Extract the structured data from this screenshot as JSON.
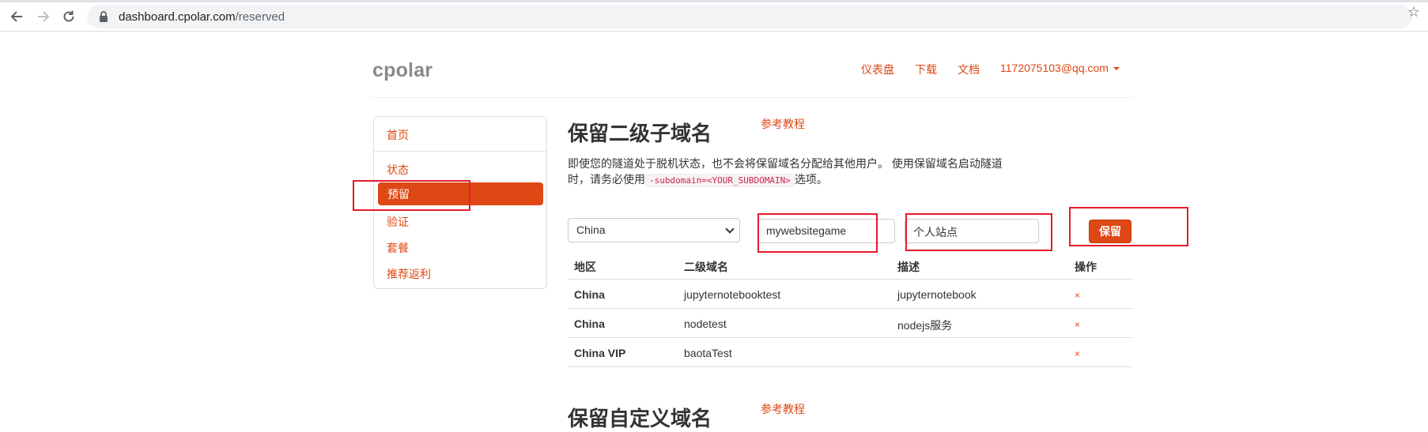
{
  "browser": {
    "url_host": "dashboard.cpolar.com",
    "url_path": "/reserved",
    "back_icon": "arrow-left-icon",
    "forward_icon": "arrow-right-icon",
    "reload_icon": "reload-icon",
    "bookmark_icon": "star-icon"
  },
  "header": {
    "logo": "cpolar",
    "nav": [
      "仪表盘",
      "下载",
      "文档"
    ],
    "account": "1172075103@qq.com"
  },
  "sidebar": {
    "items": [
      "首页",
      "状态",
      "预留",
      "验证",
      "套餐",
      "推荐返利"
    ],
    "active": "预留"
  },
  "main": {
    "title": "保留二级子域名",
    "ref_link": "参考教程",
    "desc_before": "即使您的隧道处于脱机状态，也不会将保留域名分配给其他用户。 使用保留域名启动隧道时，请务必使用",
    "desc_code": "-subdomain=<YOUR_SUBDOMAIN>",
    "desc_after": "选项。",
    "form": {
      "region": "China",
      "subdomain": "mywebsitegame",
      "description": "个人站点",
      "save_label": "保留"
    },
    "table": {
      "headers": [
        "地区",
        "二级域名",
        "描述",
        "操作"
      ],
      "rows": [
        {
          "region": "China",
          "subdomain": "jupyternotebooktest",
          "desc": "jupyternotebook",
          "action": "×"
        },
        {
          "region": "China",
          "subdomain": "nodetest",
          "desc": "nodejs服务",
          "action": "×"
        },
        {
          "region": "China VIP",
          "subdomain": "baotaTest",
          "desc": "",
          "action": "×"
        }
      ]
    },
    "second_title": "保留自定义域名",
    "second_ref_link": "参考教程"
  },
  "colors": {
    "accent": "#dd4814",
    "annotation": "#e8192c"
  }
}
